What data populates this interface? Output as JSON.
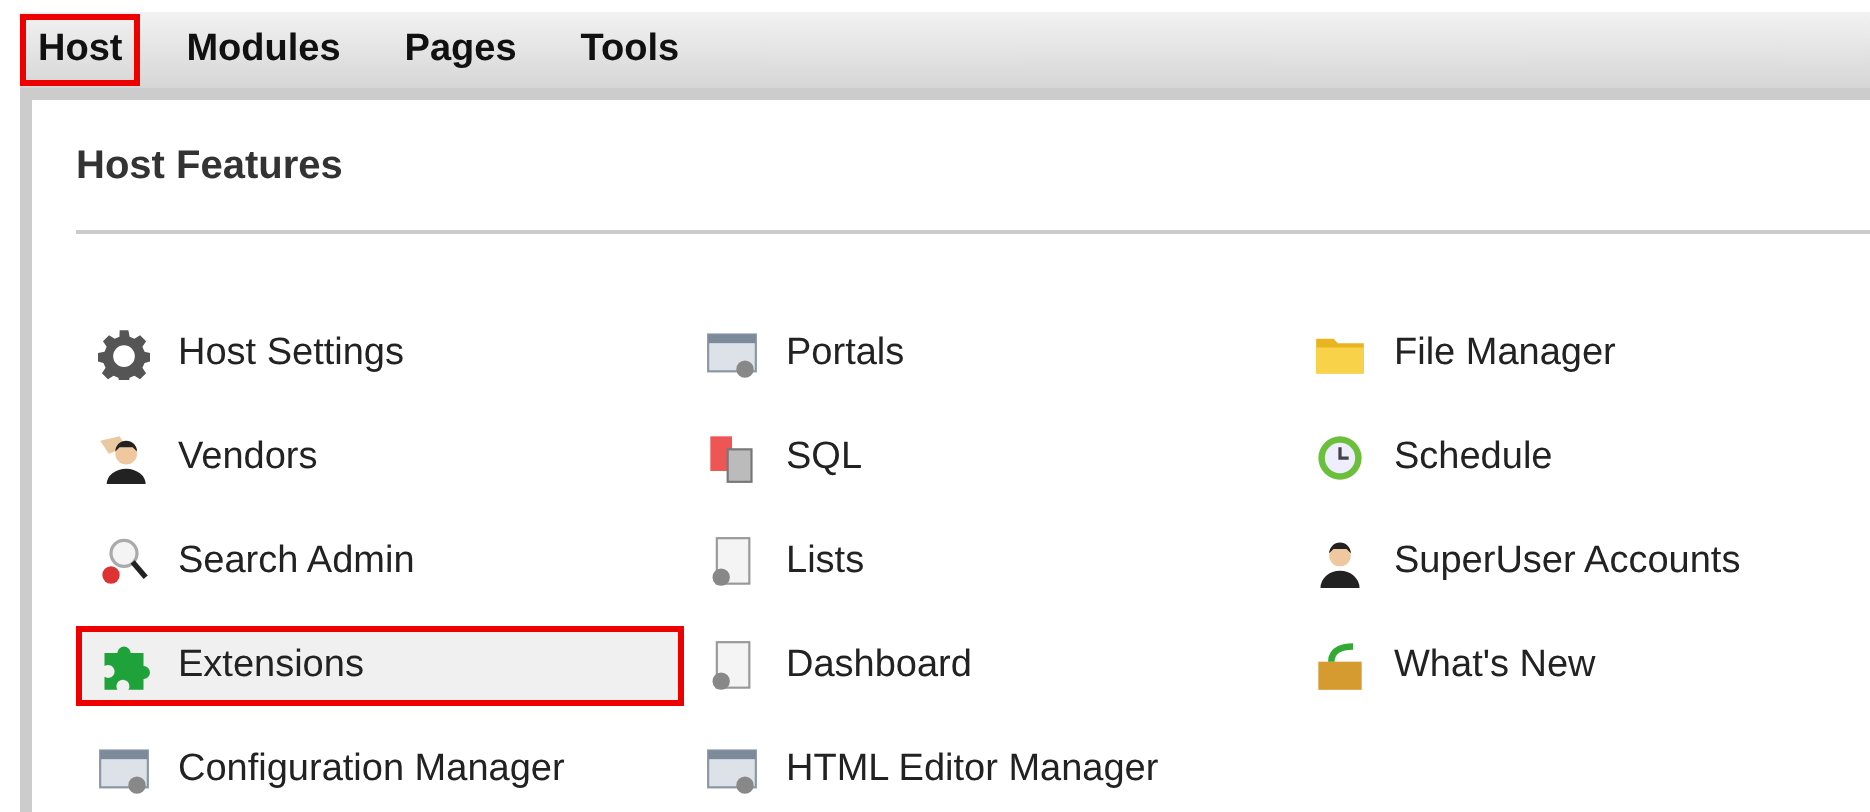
{
  "menu": [
    {
      "label": "Host",
      "selected": true
    },
    {
      "label": "Modules",
      "selected": false
    },
    {
      "label": "Pages",
      "selected": false
    },
    {
      "label": "Tools",
      "selected": false
    }
  ],
  "panel": {
    "title": "Host Features",
    "columns": [
      [
        {
          "label": "Host Settings",
          "highlighted": false
        },
        {
          "label": "Vendors",
          "highlighted": false
        },
        {
          "label": "Search Admin",
          "highlighted": false
        },
        {
          "label": "Extensions",
          "highlighted": true
        },
        {
          "label": "Configuration Manager",
          "highlighted": false
        }
      ],
      [
        {
          "label": "Portals",
          "highlighted": false
        },
        {
          "label": "SQL",
          "highlighted": false
        },
        {
          "label": "Lists",
          "highlighted": false
        },
        {
          "label": "Dashboard",
          "highlighted": false
        },
        {
          "label": "HTML Editor Manager",
          "highlighted": false
        }
      ],
      [
        {
          "label": "File Manager",
          "highlighted": false
        },
        {
          "label": "Schedule",
          "highlighted": false
        },
        {
          "label": "SuperUser Accounts",
          "highlighted": false
        },
        {
          "label": "What's New",
          "highlighted": false
        }
      ]
    ]
  }
}
